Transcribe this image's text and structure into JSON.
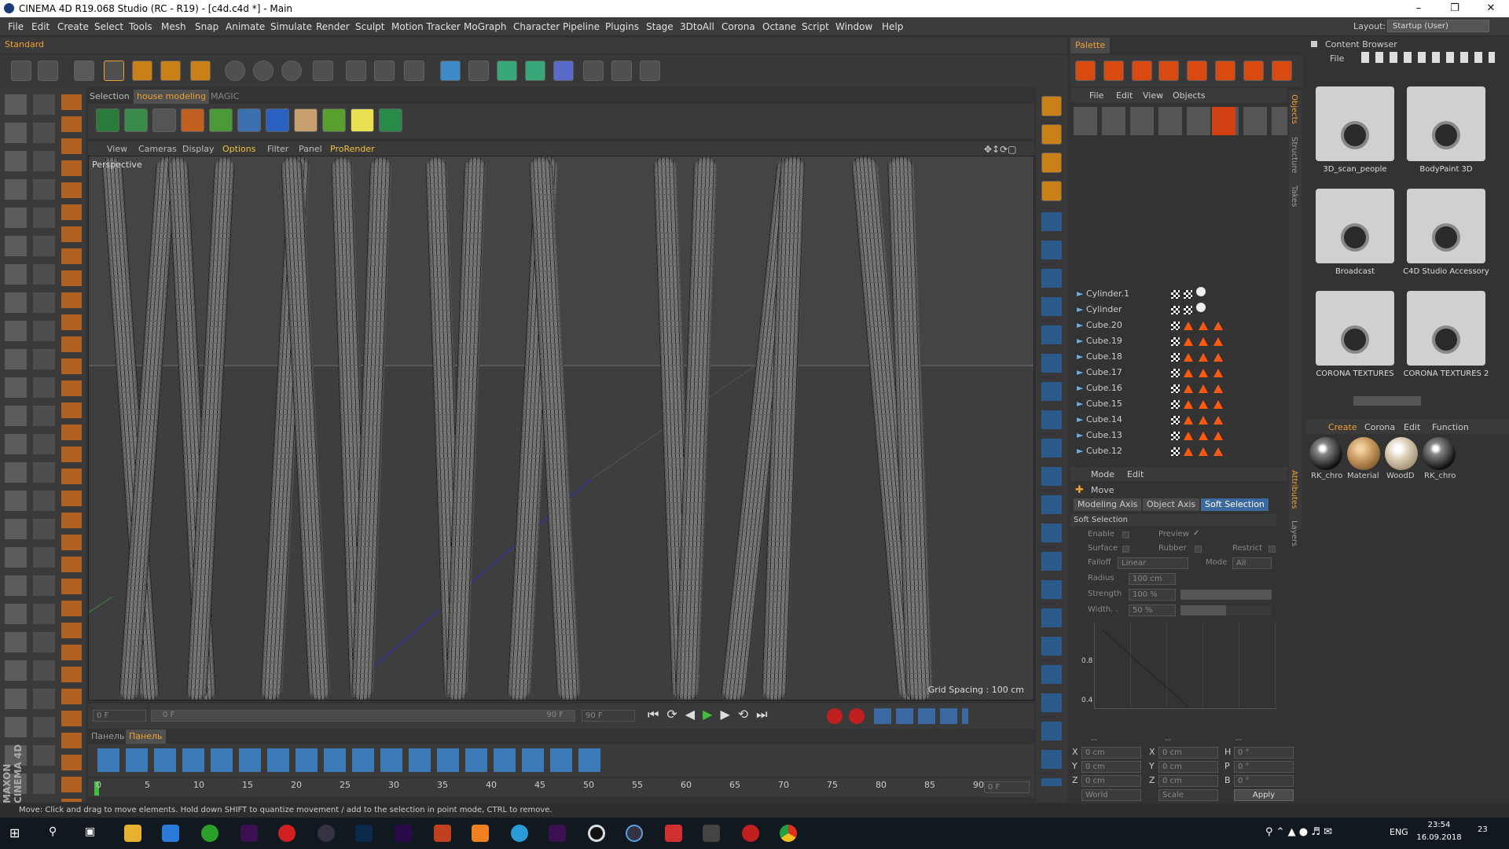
{
  "window": {
    "title": "CINEMA 4D R19.068 Studio (RC - R19) - [c4d.c4d *] - Main"
  },
  "menu": [
    "File",
    "Edit",
    "Create",
    "Select",
    "Tools",
    "Mesh",
    "Snap",
    "Animate",
    "Simulate",
    "Render",
    "Sculpt",
    "Motion Tracker",
    "MoGraph",
    "Character",
    "Pipeline",
    "Plugins",
    "Stage",
    "3DtoAll",
    "Corona",
    "Octane",
    "Script",
    "Window",
    "Help"
  ],
  "layout": {
    "label": "Layout:",
    "value": "Startup (User)"
  },
  "left_tab": "Standard",
  "palette_tab": "Palette",
  "shelf_tabs": [
    "Selection",
    "house modeling",
    "MAGIC"
  ],
  "viewport_menu": [
    "View",
    "Cameras",
    "Display",
    "Options",
    "Filter",
    "Panel",
    "ProRender"
  ],
  "viewport": {
    "label": "Perspective",
    "grid": "Grid Spacing : 100 cm"
  },
  "timeline": {
    "start": "0 F",
    "slider_start": "0 F",
    "slider_end": "90 F",
    "end": "90 F",
    "current": "0 F",
    "ticks": [
      "0",
      "5",
      "10",
      "15",
      "20",
      "25",
      "30",
      "35",
      "40",
      "45",
      "50",
      "55",
      "60",
      "65",
      "70",
      "75",
      "80",
      "85",
      "90"
    ]
  },
  "bottom_tabs": [
    "Панель",
    "Панель"
  ],
  "status": "Move: Click and drag to move elements. Hold down SHIFT to quantize movement / add to the selection in point mode, CTRL to remove.",
  "objects_menu": [
    "File",
    "Edit",
    "View",
    "Objects"
  ],
  "objects": [
    "Cylinder.1",
    "Cylinder",
    "Cube.20",
    "Cube.19",
    "Cube.18",
    "Cube.17",
    "Cube.16",
    "Cube.15",
    "Cube.14",
    "Cube.13",
    "Cube.12"
  ],
  "side_tabs": [
    "Objects",
    "Structure",
    "Takes",
    "Attributes",
    "Layers"
  ],
  "attributes": {
    "menu": [
      "Mode",
      "Edit"
    ],
    "tool": "Move",
    "tabs": [
      "Modeling Axis",
      "Object Axis",
      "Soft Selection"
    ],
    "section": "Soft Selection",
    "enable": "Enable",
    "preview": "Preview",
    "surface": "Surface",
    "rubber": "Rubber",
    "restrict": "Restrict",
    "falloff": "Falloff",
    "falloff_val": "Linear",
    "mode": "Mode",
    "mode_val": "All",
    "radius": "Radius",
    "radius_val": "100 cm",
    "strength": "Strength",
    "strength_val": "100 %",
    "width": "Width. .",
    "width_val": "50 %",
    "graph_y1": "0.8",
    "graph_y2": "0.4"
  },
  "coords": {
    "header": [
      "--",
      "--",
      "--"
    ],
    "rows": [
      {
        "a": "X",
        "av": "0 cm",
        "b": "X",
        "bv": "0 cm",
        "c": "H",
        "cv": "0 °"
      },
      {
        "a": "Y",
        "av": "0 cm",
        "b": "Y",
        "bv": "0 cm",
        "c": "P",
        "cv": "0 °"
      },
      {
        "a": "Z",
        "av": "0 cm",
        "b": "Z",
        "bv": "0 cm",
        "c": "B",
        "cv": "0 °"
      }
    ],
    "world": "World",
    "scale": "Scale",
    "apply": "Apply"
  },
  "content_browser": {
    "title": "Content Browser",
    "menu": "File",
    "items": [
      "3D_scan_people",
      "BodyPaint 3D",
      "Broadcast",
      "C4D Studio Accessory",
      "CORONA  TEXTURES",
      "CORONA TEXTURES 2"
    ]
  },
  "materials": {
    "menu": [
      "Create",
      "Corona",
      "Edit",
      "Function"
    ],
    "items": [
      {
        "name": "RK_chro",
        "color": "#111111"
      },
      {
        "name": "Material",
        "color": "#c89a60"
      },
      {
        "name": "WoodD",
        "color": "#d8c8b0"
      },
      {
        "name": "RK_chro",
        "color": "#111111"
      }
    ]
  },
  "brand": "MAXON CINEMA 4D",
  "taskbar": {
    "time": "23:54",
    "date": "16.09.2018",
    "lang": "ENG",
    "notif": "23"
  }
}
